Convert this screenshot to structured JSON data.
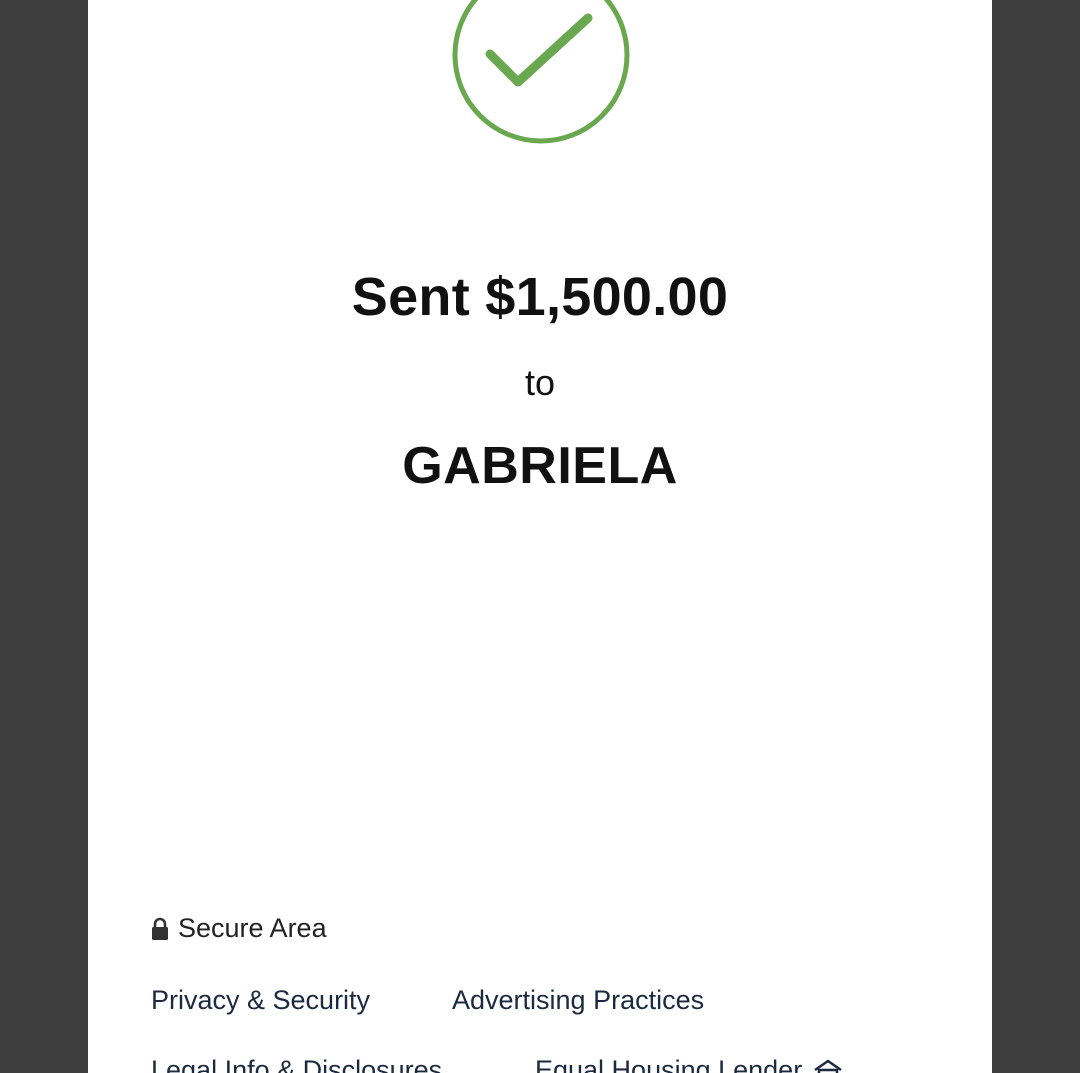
{
  "confirmation": {
    "amount_text": "Sent $1,500.00",
    "connector_text": "to",
    "recipient_name": "GABRIELA",
    "check_icon": "check-circle-icon",
    "check_color": "#6aa84f"
  },
  "footer": {
    "secure_label": "Secure Area",
    "secure_icon": "lock-icon",
    "links": {
      "privacy": "Privacy & Security",
      "advertising": "Advertising Practices",
      "legal": "Legal Info & Disclosures",
      "equal_housing": "Equal Housing Lender"
    },
    "equal_housing_icon": "house-icon"
  },
  "colors": {
    "background_frame": "#3e3e3e",
    "screen": "#ffffff",
    "text": "#111111",
    "link": "#1b2a3f"
  }
}
